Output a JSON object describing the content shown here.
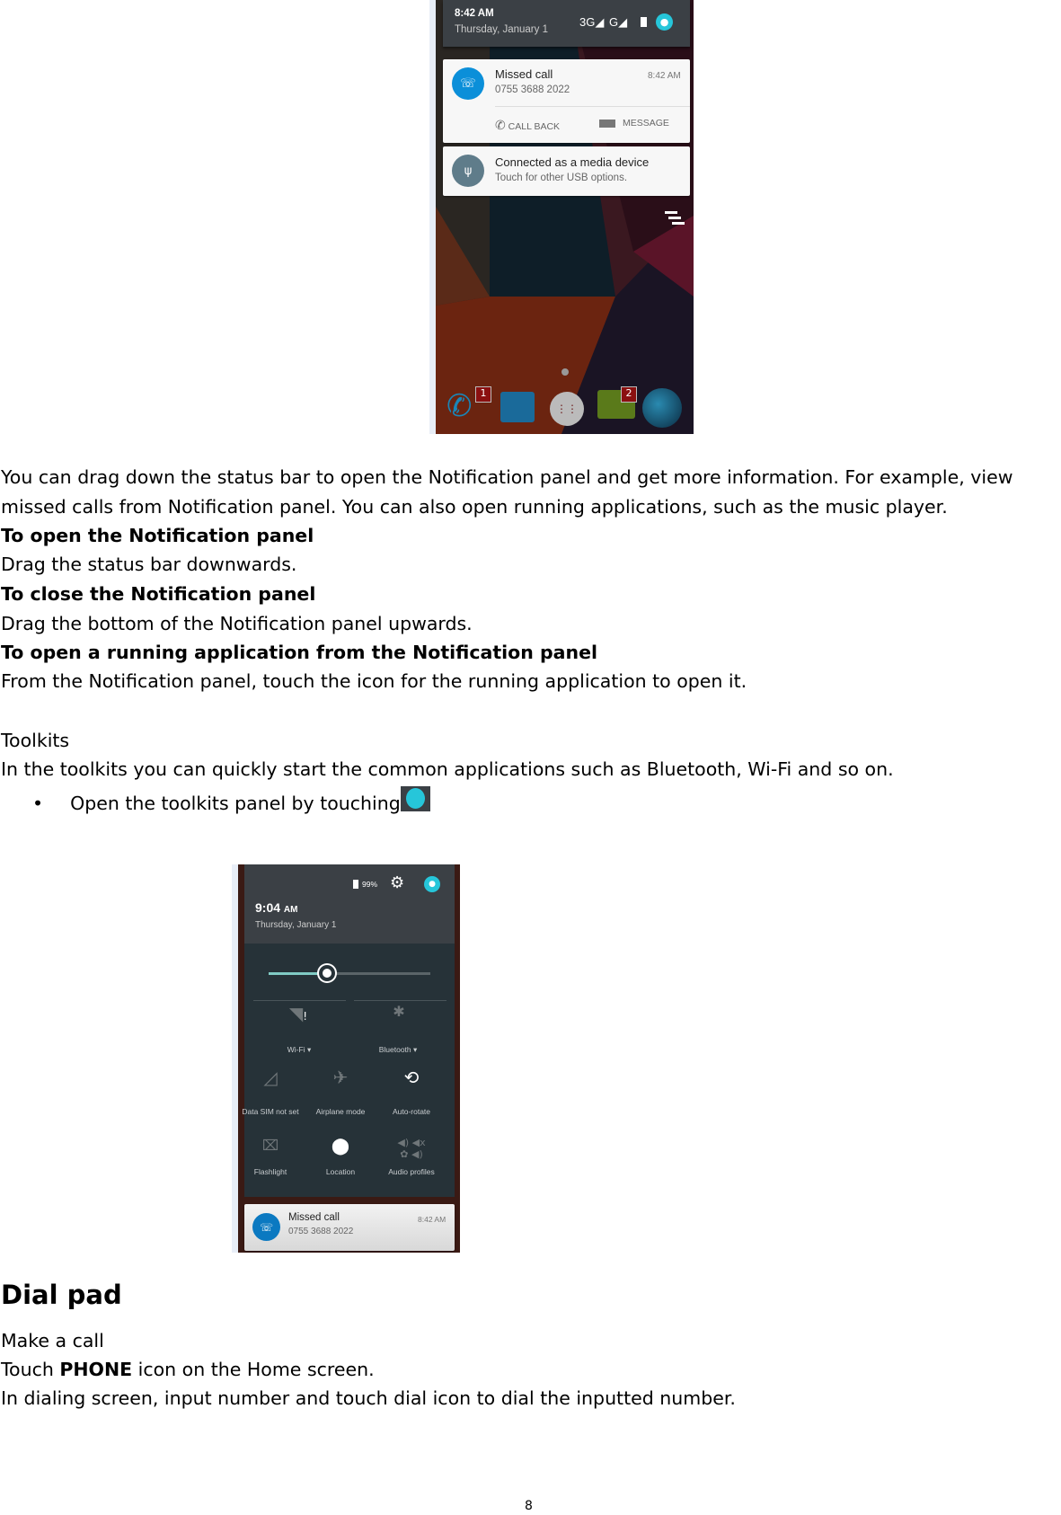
{
  "screenshot1": {
    "status_time": "8:42 AM",
    "status_date": "Thursday, January 1",
    "signal_labels": [
      "3G",
      "G"
    ],
    "notifications": [
      {
        "title": "Missed call",
        "subtitle": "0755 3688 2022",
        "time": "8:42 AM",
        "actions": [
          "CALL BACK",
          "MESSAGE"
        ]
      },
      {
        "title": "Connected as a media device",
        "subtitle": "Touch for other USB options."
      }
    ],
    "dock_badges": [
      "1",
      "2"
    ],
    "colors": {
      "header": "#3b4045",
      "accent": "#0b8fd9",
      "usb": "#5f7c8a"
    }
  },
  "body": {
    "intro_line1": "You can drag down the status bar to open the Notification panel and get more information. For example, view",
    "intro_line2": "missed calls from Notification panel. You can also open running applications, such as the music player.",
    "h_open": "To open the Notification panel",
    "p_open": "Drag the status bar downwards.",
    "h_close": "To close the Notification panel",
    "p_close": "Drag the bottom of the Notification panel upwards.",
    "h_running": "To open a running application from the Notification panel",
    "p_running": "From the Notification panel, touch the icon for the running application to open it.",
    "toolkits_title": "Toolkits",
    "toolkits_text": "In the toolkits you can quickly start the common applications such as Bluetooth, Wi-Fi and so on.",
    "bullet": "Open the toolkits panel by touching"
  },
  "screenshot2": {
    "battery": "99%",
    "time": "9:04",
    "ampm": "AM",
    "date": "Thursday, January 1",
    "brightness": 0.36,
    "wifi_label": "Wi-Fi",
    "bluetooth_label": "Bluetooth",
    "tiles": [
      "Data SIM not set",
      "Airplane mode",
      "Auto-rotate",
      "Flashlight",
      "Location",
      "Audio profiles"
    ],
    "notification": {
      "title": "Missed call",
      "subtitle": "0755 3688 2022",
      "time": "8:42 AM"
    }
  },
  "dialpad": {
    "heading": "Dial pad",
    "make_call": "Make a call",
    "touch_prefix": "Touch ",
    "touch_bold": "PHONE",
    "touch_suffix": " icon on the Home screen.",
    "dialing": "In dialing screen, input number and touch dial icon to dial the inputted number."
  },
  "page_number": "8"
}
